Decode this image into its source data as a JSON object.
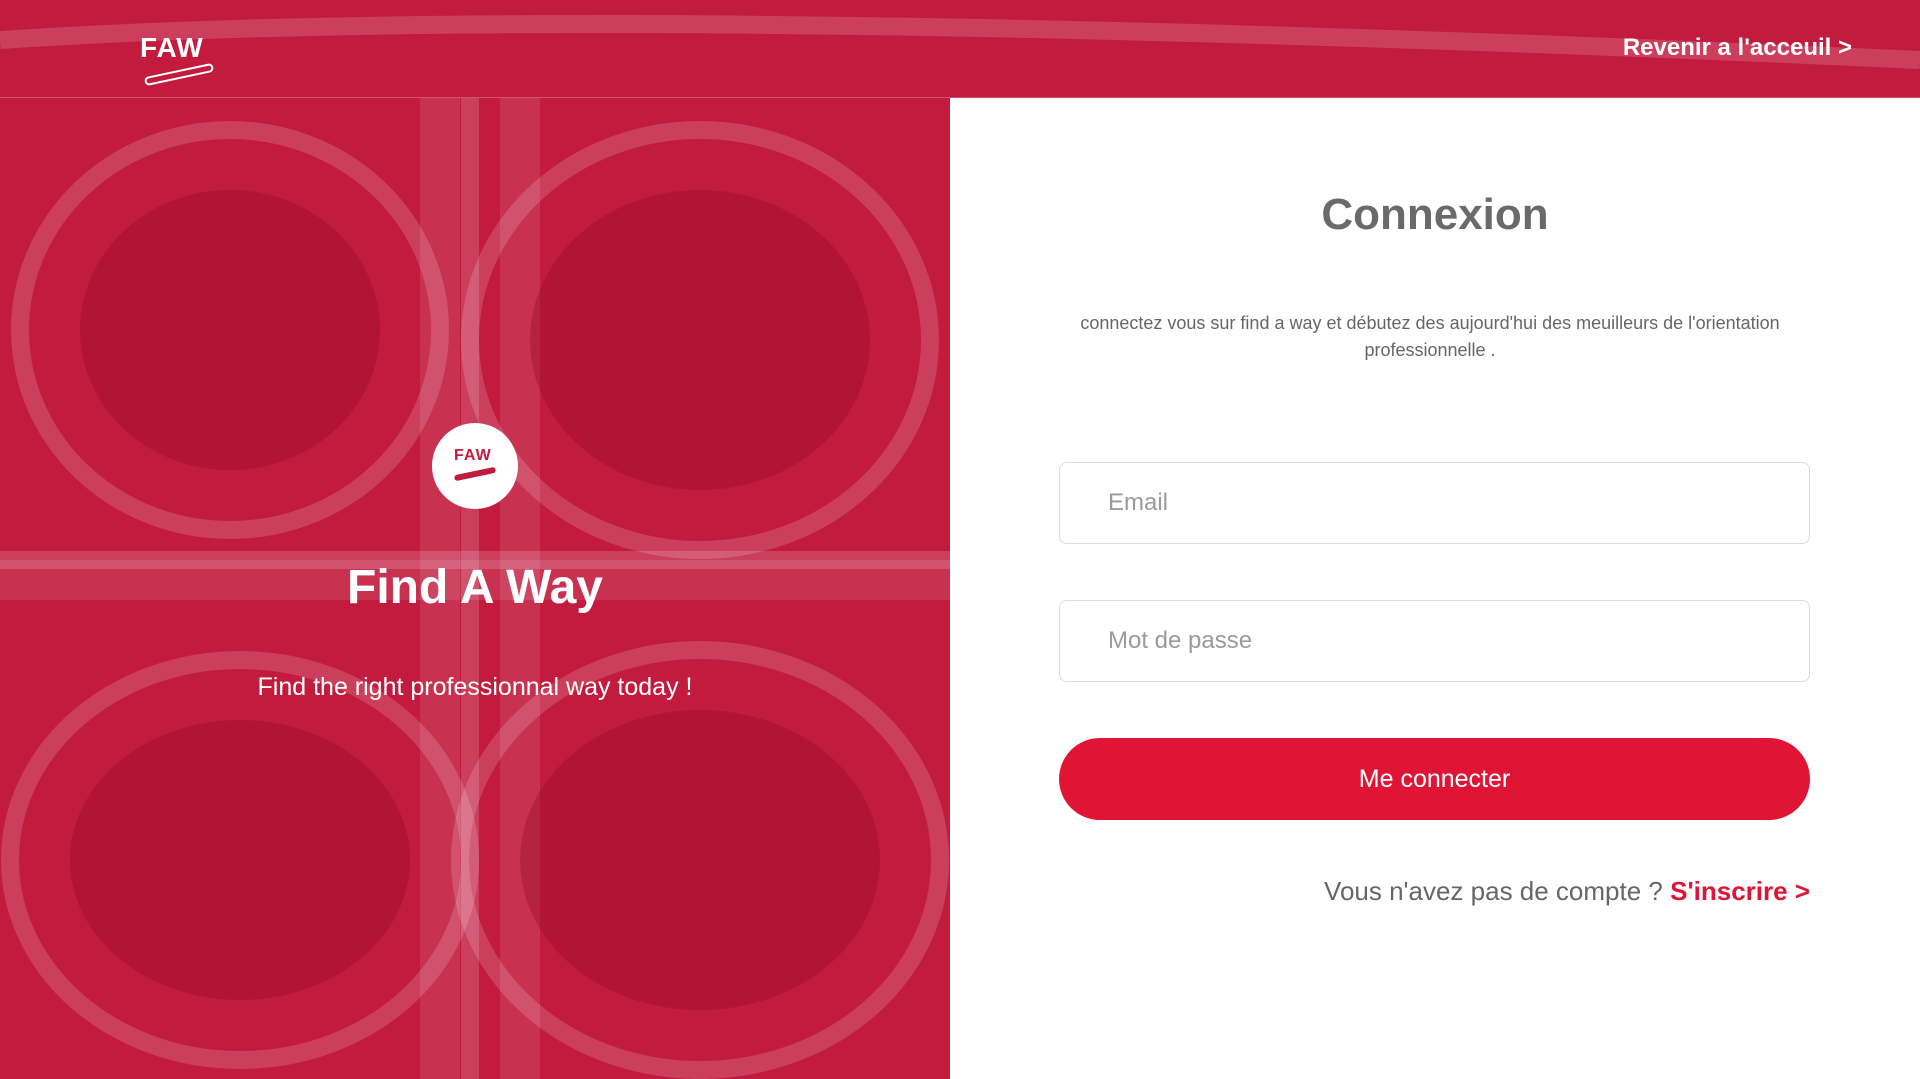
{
  "header": {
    "logo_text": "FAW",
    "back_link": "Revenir a l'acceuil >"
  },
  "hero": {
    "badge_text": "FAW",
    "title": "Find A Way",
    "subtitle": "Find the right professionnal way today !"
  },
  "login": {
    "title": "Connexion",
    "description": "connectez vous sur find a way et débutez des aujourd'hui des meuilleurs de l'orientation professionnelle .",
    "email_placeholder": "Email",
    "password_placeholder": "Mot de passe",
    "submit_label": "Me connecter",
    "signup_prompt": "Vous n'avez pas de compte ? ",
    "signup_link": "S'inscrire >"
  },
  "colors": {
    "brand": "#e01536",
    "hero_overlay": "#c21b3d",
    "title_gray": "#6a6a6a"
  }
}
